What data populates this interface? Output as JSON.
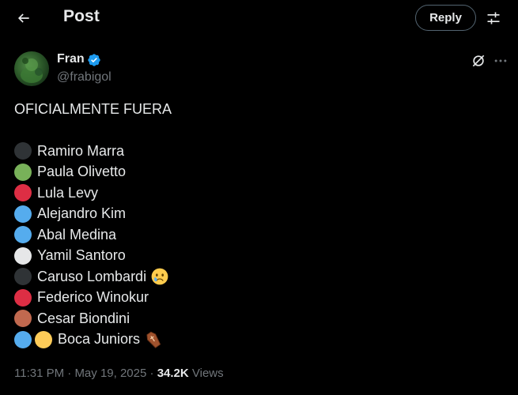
{
  "header": {
    "title": "Post",
    "reply_label": "Reply"
  },
  "author": {
    "name": "Fran",
    "handle": "@frabigol",
    "verified": true
  },
  "tweet": {
    "text": "OFICIALMENTE FUERA",
    "items": [
      {
        "label": "Ramiro Marra",
        "dots": [
          "#2f3336"
        ],
        "emoji": ""
      },
      {
        "label": "Paula Olivetto",
        "dots": [
          "#78b159"
        ],
        "emoji": ""
      },
      {
        "label": "Lula Levy",
        "dots": [
          "#dd2e44"
        ],
        "emoji": ""
      },
      {
        "label": "Alejandro Kim",
        "dots": [
          "#55acee"
        ],
        "emoji": ""
      },
      {
        "label": "Abal Medina",
        "dots": [
          "#55acee"
        ],
        "emoji": ""
      },
      {
        "label": "Yamil Santoro",
        "dots": [
          "#e6e7e8"
        ],
        "emoji": ""
      },
      {
        "label": "Caruso Lombardi",
        "dots": [
          "#2f3336"
        ],
        "emoji": "crying-face-icon"
      },
      {
        "label": "Federico Winokur",
        "dots": [
          "#dd2e44"
        ],
        "emoji": ""
      },
      {
        "label": "Cesar Biondini",
        "dots": [
          "#c1694f"
        ],
        "emoji": ""
      },
      {
        "label": "Boca Juniors",
        "dots": [
          "#55acee",
          "#fdcb58"
        ],
        "emoji": "coffin-icon"
      }
    ]
  },
  "meta": {
    "time": "11:31 PM",
    "date": "May 19, 2025",
    "views_count": "34.2K",
    "views_label": "Views",
    "separator": "·"
  },
  "colors": {
    "background": "#000000",
    "text": "#e7e9ea",
    "muted": "#71767b",
    "border": "#536471",
    "verified": "#1d9bf0"
  }
}
